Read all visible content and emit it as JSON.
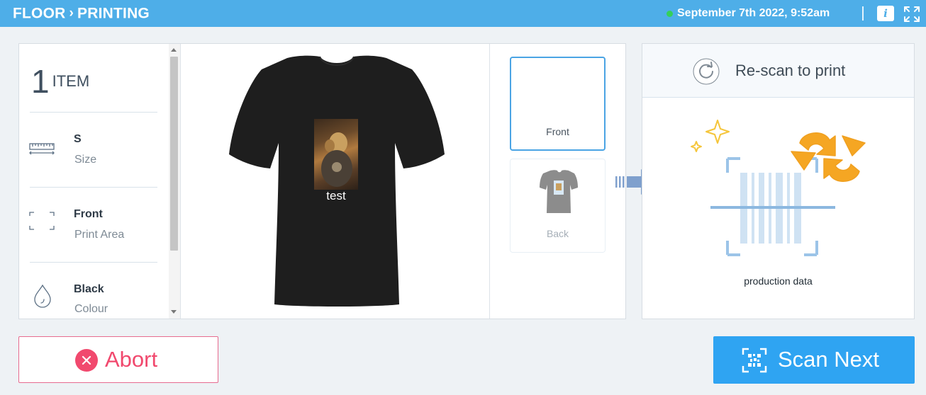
{
  "header": {
    "breadcrumb": [
      "FLOOR",
      "PRINTING"
    ],
    "separator": "›",
    "datetime": "September 7th 2022, 9:52am",
    "status_color": "#35d05a",
    "info_label": "i",
    "bar_color": "#4eaee8"
  },
  "details": {
    "count": "1",
    "count_unit": "ITEM",
    "attributes": [
      {
        "icon": "ruler-icon",
        "value": "S",
        "label": "Size"
      },
      {
        "icon": "print-area-icon",
        "value": "Front",
        "label": "Print Area"
      },
      {
        "icon": "colour-drop-icon",
        "value": "Black",
        "label": "Colour"
      }
    ]
  },
  "preview": {
    "garment_color": "#1e1e1e",
    "print_text": "test"
  },
  "sides": [
    {
      "label": "Front",
      "selected": true
    },
    {
      "label": "Back",
      "selected": false
    }
  ],
  "rescan": {
    "title": "Re-scan to print",
    "caption": "production data"
  },
  "actions": {
    "abort_label": "Abort",
    "scan_label": "Scan Next",
    "abort_color": "#f1496e",
    "scan_color": "#2fa4f2"
  }
}
